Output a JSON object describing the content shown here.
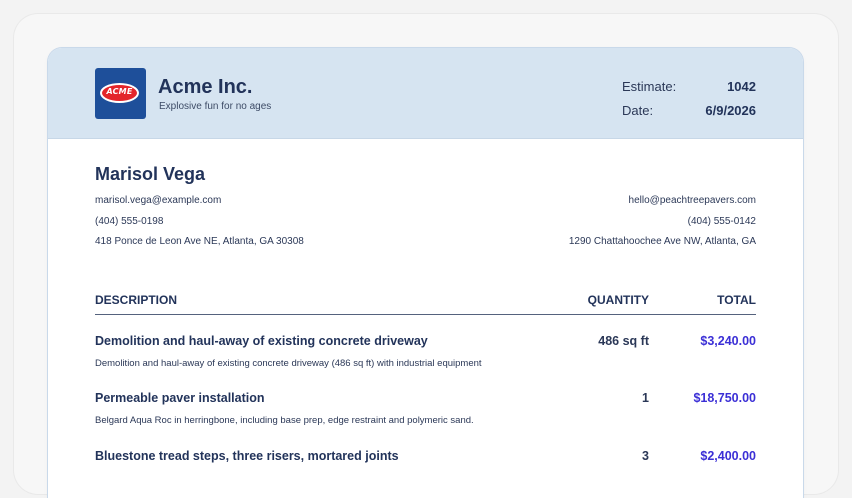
{
  "company": {
    "logo_text": "ACME",
    "name": "Acme Inc.",
    "tagline": "Explosive fun for no ages"
  },
  "meta": {
    "estimate_label": "Estimate:",
    "estimate_value": "1042",
    "date_label": "Date:",
    "date_value": "6/9/2026"
  },
  "client": {
    "name": "Marisol Vega",
    "email": "marisol.vega@example.com",
    "phone": "(404) 555-0198",
    "address": "418 Ponce de Leon Ave NE, Atlanta, GA 30308"
  },
  "vendor": {
    "email": "hello@peachtreepavers.com",
    "phone": "(404) 555-0142",
    "address": "1290 Chattahoochee Ave NW, Atlanta, GA"
  },
  "table": {
    "headers": {
      "description": "DESCRIPTION",
      "quantity": "QUANTITY",
      "total": "TOTAL"
    },
    "rows": [
      {
        "title": "Demolition and haul-away of existing concrete driveway",
        "description": "Demolition and haul-away of existing concrete driveway (486 sq ft) with industrial equipment",
        "quantity": "486 sq ft",
        "total": "$3,240.00"
      },
      {
        "title": "Permeable paver installation",
        "description": "Belgard Aqua Roc in herringbone, including base prep, edge restraint and polymeric sand.",
        "quantity": "1",
        "total": "$18,750.00"
      },
      {
        "title": "Bluestone tread steps, three risers, mortared joints",
        "description": "",
        "quantity": "3",
        "total": "$2,400.00"
      }
    ]
  },
  "colors": {
    "header_background": "#d6e4f1",
    "heading_text": "#22335a",
    "total_accent": "#3b2fd6",
    "logo_blue": "#1e4f9a",
    "logo_red": "#e3262b"
  }
}
